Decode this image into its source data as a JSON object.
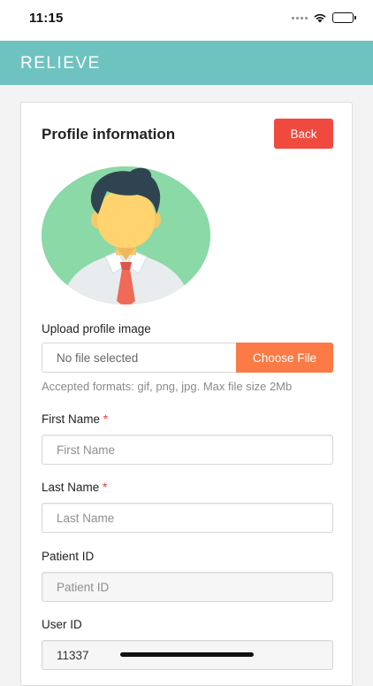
{
  "status_bar": {
    "time": "11:15",
    "icons": [
      "signal-dots-icon",
      "wifi-icon",
      "battery-icon"
    ]
  },
  "app": {
    "title": "RELIEVE",
    "header_color": "#6ec3c1"
  },
  "profile": {
    "title": "Profile information",
    "back_label": "Back",
    "back_color": "#f04a3f",
    "avatar_icon": "user-avatar-icon",
    "upload_label": "Upload profile image",
    "file_placeholder": "No file selected",
    "choose_file_label": "Choose File",
    "choose_file_color": "#fb7a45",
    "accepted_formats": "Accepted formats: gif, png, jpg. Max file size 2Mb"
  },
  "form": {
    "first_name": {
      "label": "First Name",
      "required": "*",
      "placeholder": "First Name",
      "value": ""
    },
    "last_name": {
      "label": "Last Name",
      "required": "*",
      "placeholder": "Last Name",
      "value": ""
    },
    "patient_id": {
      "label": "Patient ID",
      "placeholder": "Patient ID",
      "value": ""
    },
    "user_id": {
      "label": "User ID",
      "value": "11337"
    }
  }
}
